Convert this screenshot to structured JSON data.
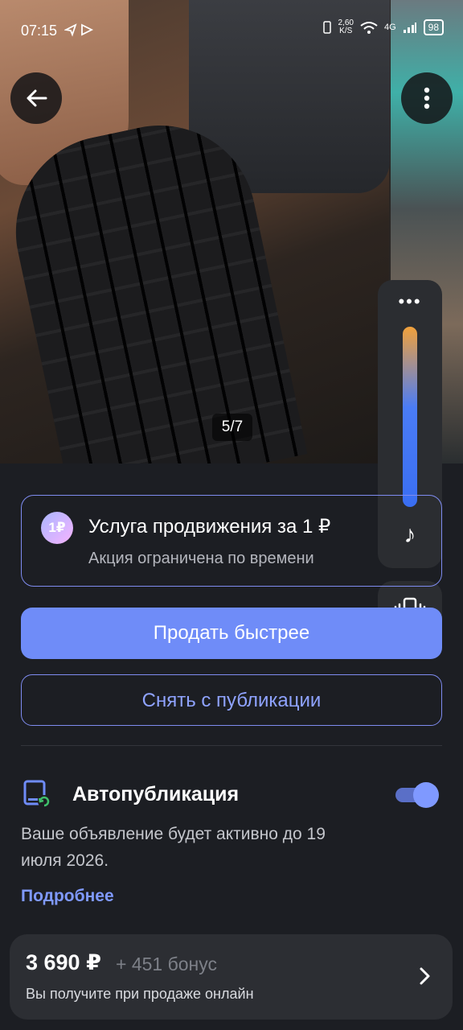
{
  "status_bar": {
    "time": "07:15",
    "net_speed": "2,60",
    "net_unit": "K/S",
    "network": "4G",
    "battery": "98"
  },
  "gallery": {
    "counter": "5/7"
  },
  "promo": {
    "badge": "1₽",
    "title": "Услуга продвижения за 1 ₽",
    "subtitle": "Акция ограничена по времени"
  },
  "buttons": {
    "sell_faster": "Продать быстрее",
    "unpublish": "Снять с публикации"
  },
  "autopublish": {
    "title": "Автопубликация",
    "enabled": true,
    "description": "Ваше объявление будет активно до 19 июля 2026.",
    "more_link": "Подробнее"
  },
  "bottom_bar": {
    "price": "3 690 ₽",
    "bonus": "+ 451 бонус",
    "caption": "Вы получите при продаже онлайн"
  },
  "volume_overlay": {
    "dots": "•••",
    "level": 1.0
  },
  "colors": {
    "accent": "#6f8cf8",
    "background": "#1c1e23",
    "card": "#2c2e33"
  }
}
